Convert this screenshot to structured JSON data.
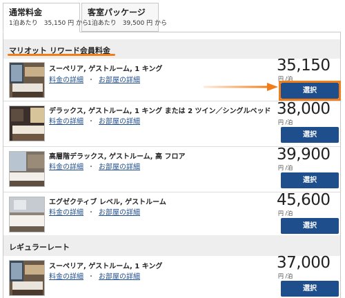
{
  "tabs": [
    {
      "title": "通常料金",
      "subtitle": "1泊あたり　35,150 円 から",
      "active": true
    },
    {
      "title": "客室パッケージ",
      "subtitle": "1泊あたり　39,500 円 から",
      "active": false
    }
  ],
  "sections": {
    "member": {
      "title": "マリオット リワード会員料金"
    },
    "regular": {
      "title": "レギュラーレート"
    }
  },
  "links": {
    "rate_details": "料金の詳細",
    "separator": "・",
    "room_details": "お部屋の詳細"
  },
  "unit_label": "円 /泊",
  "select_label": "選択",
  "rooms": [
    {
      "name": "スーペリア, ゲストルーム, 1 キング",
      "price": "35,150"
    },
    {
      "name": "デラックス, ゲストルーム, 1 キング または 2 ツイン／シングルベッド",
      "price": "38,000"
    },
    {
      "name": "高層階デラックス, ゲストルーム, 高 フロア",
      "price": "39,900"
    },
    {
      "name": "エグゼクティブ レベル, ゲストルーム",
      "price": "45,600"
    },
    {
      "name": "スーペリア, ゲストルーム, 1 キング",
      "price": "37,000"
    }
  ],
  "colors": {
    "accent_orange": "#f07d17",
    "button_blue": "#1f4e8c",
    "link_blue": "#1f4e8c"
  }
}
